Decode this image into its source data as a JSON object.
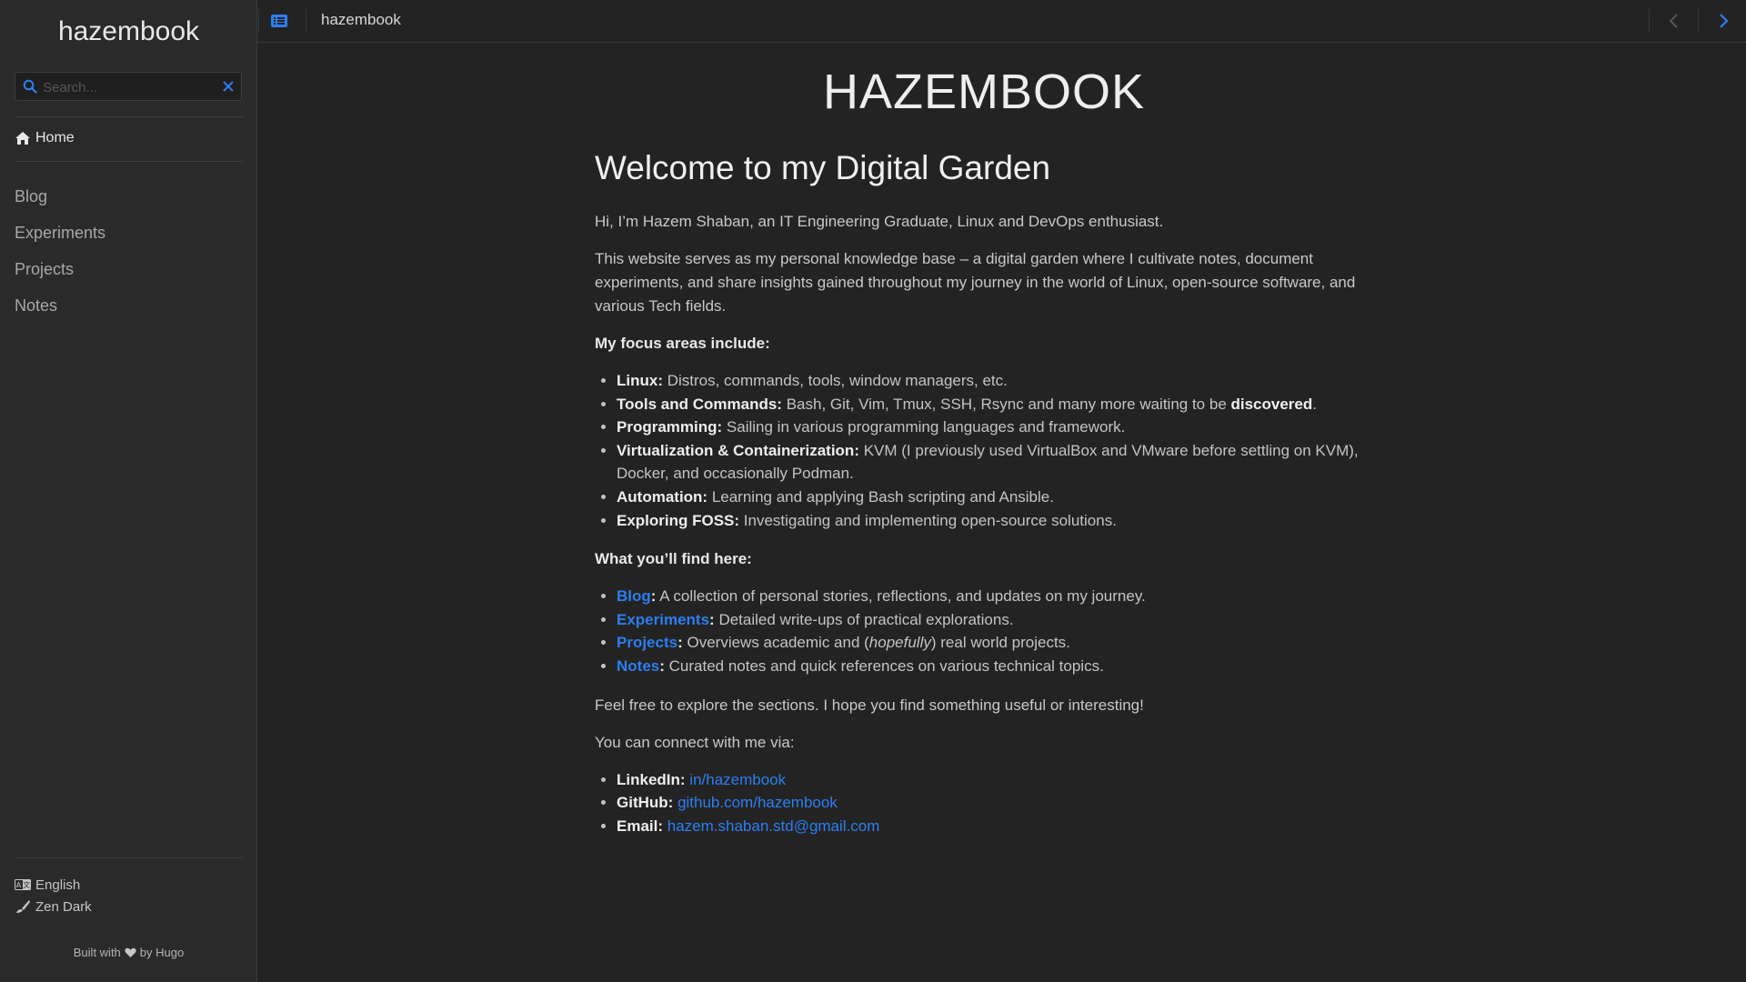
{
  "sidebar": {
    "site_title": "hazembook",
    "search_placeholder": "Search...",
    "home_label": "Home",
    "nav": [
      "Blog",
      "Experiments",
      "Projects",
      "Notes"
    ],
    "language_label": "English",
    "theme_label": "Zen Dark",
    "built_with_prefix": "Built with",
    "built_with_suffix": "by Hugo"
  },
  "header": {
    "title": "hazembook"
  },
  "main": {
    "brand": "HAZEMBOOK",
    "heading": "Welcome to my Digital Garden",
    "intro": "Hi, I’m Hazem Shaban, an IT Engineering Graduate, Linux and DevOps enthusiast.",
    "description": "This website serves as my personal knowledge base – a digital garden where I cultivate notes, document experiments, and share insights gained throughout my journey in the world of Linux, open-source software, and various Tech fields.",
    "focus_heading": "My focus areas include:",
    "focus": [
      {
        "label": "Linux:",
        "text": " Distros, commands, tools, window managers, etc."
      },
      {
        "label": "Tools and Commands:",
        "text": " Bash, Git, Vim, Tmux, SSH, Rsync and many more waiting to be ",
        "highlight": "discovered",
        "tail": "."
      },
      {
        "label": "Programming:",
        "text": " Sailing in various programming languages and framework."
      },
      {
        "label": "Virtualization & Containerization:",
        "text": " KVM (I previously used VirtualBox and VMware before settling on KVM), Docker, and occasionally Podman."
      },
      {
        "label": "Automation:",
        "text": " Learning and applying Bash scripting and Ansible."
      },
      {
        "label": "Exploring FOSS:",
        "text": " Investigating and implementing open-source solutions."
      }
    ],
    "find_heading": "What you’ll find here:",
    "find": [
      {
        "link": "Blog",
        "text": " A collection of personal stories, reflections, and updates on my journey."
      },
      {
        "link": "Experiments",
        "text": " Detailed write-ups of practical explorations."
      },
      {
        "link": "Projects",
        "text": " Overviews academic and (",
        "em": "hopefully",
        "tail": ") real world projects."
      },
      {
        "link": "Notes",
        "text": " Curated notes and quick references on various technical topics."
      }
    ],
    "explore": "Feel free to explore the sections. I hope you find something useful or interesting!",
    "connect": "You can connect with me via:",
    "contacts": [
      {
        "label": "LinkedIn:",
        "value": "in/hazembook"
      },
      {
        "label": "GitHub:",
        "value": "github.com/hazembook"
      },
      {
        "label": "Email:",
        "value": "hazem.shaban.std@gmail.com"
      }
    ]
  },
  "colors": {
    "background": "#232323",
    "sidebar": "#2a2a2a",
    "accent": "#2d7ef0"
  }
}
